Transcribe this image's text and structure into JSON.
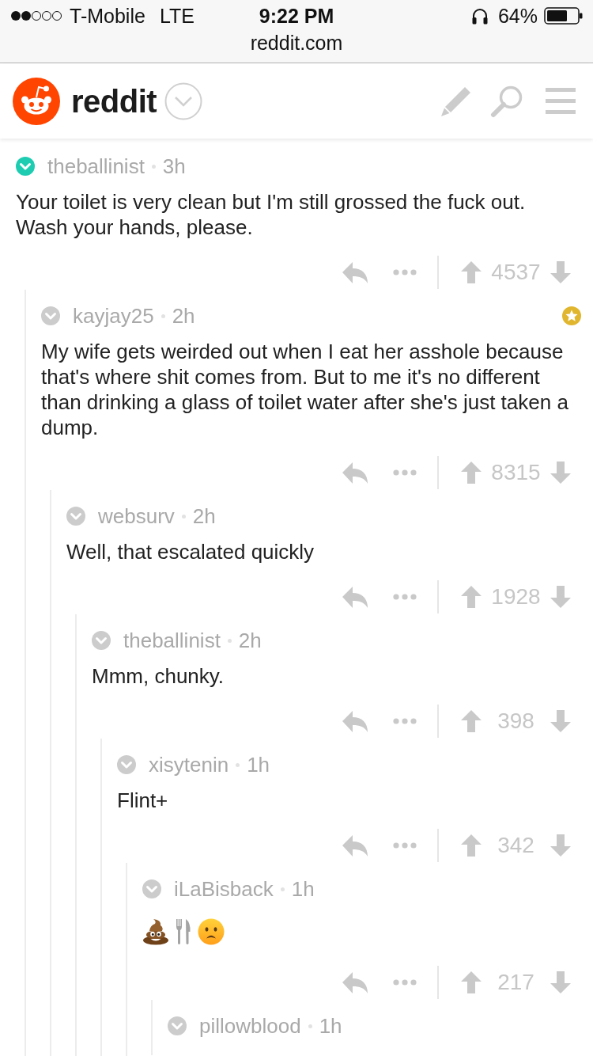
{
  "status_bar": {
    "carrier": "T-Mobile",
    "network": "LTE",
    "time": "9:22 PM",
    "battery": "64%",
    "url": "reddit.com"
  },
  "header": {
    "logo_text": "reddit"
  },
  "comments": [
    {
      "author": "theballinist",
      "age": "3h",
      "highlighted": true,
      "gilded": false,
      "body": "Your toilet is very clean but I'm still grossed the fuck out.\nWash your hands, please.",
      "score": "4537",
      "children": [
        {
          "author": "kayjay25",
          "age": "2h",
          "highlighted": false,
          "gilded": true,
          "body": "My wife gets weirded out when I eat her asshole because that's where shit comes from. But to me it's no different than drinking a glass of toilet water after she's just taken a dump.",
          "score": "8315",
          "children": [
            {
              "author": "websurv",
              "age": "2h",
              "highlighted": false,
              "gilded": false,
              "body": "Well, that escalated quickly",
              "score": "1928",
              "children": [
                {
                  "author": "theballinist",
                  "age": "2h",
                  "highlighted": false,
                  "gilded": false,
                  "body": "Mmm, chunky.",
                  "score": "398",
                  "children": [
                    {
                      "author": "xisytenin",
                      "age": "1h",
                      "highlighted": false,
                      "gilded": false,
                      "body": "Flint+",
                      "score": "342",
                      "children": [
                        {
                          "author": "iLaBisback",
                          "age": "1h",
                          "highlighted": false,
                          "gilded": false,
                          "emoji": [
                            {
                              "kind": "poop"
                            },
                            {
                              "kind": "fork_and_knife"
                            },
                            {
                              "kind": "frowning_face"
                            }
                          ],
                          "score": "217",
                          "children": [
                            {
                              "author": "pillowblood",
                              "age": "1h",
                              "highlighted": false,
                              "gilded": false
                            }
                          ]
                        }
                      ]
                    }
                  ]
                }
              ]
            }
          ]
        }
      ]
    }
  ]
}
